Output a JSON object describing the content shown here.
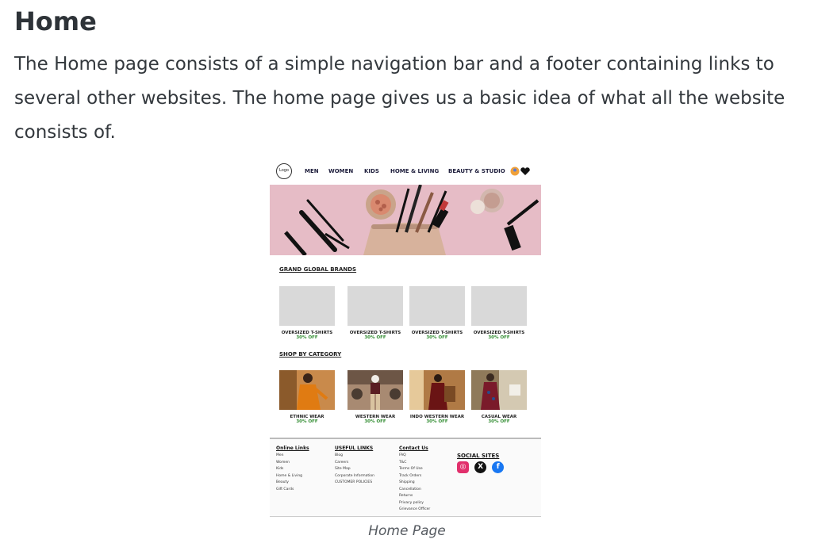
{
  "document": {
    "title": "Home",
    "paragraph": "The Home page consists of a simple navigation bar and a footer containing links to several other websites. The home page gives us a basic idea of what all the website consists of.",
    "caption": "Home Page"
  },
  "mockup": {
    "logo_text": "Logo",
    "nav_items": [
      "MEN",
      "WOMEN",
      "KIDS",
      "HOME & LIVING",
      "BEAUTY & STUDIO"
    ],
    "brands_heading": "GRAND GLOBAL BRANDS",
    "brand_cards": [
      {
        "name": "OVERSIZED T-SHIRTS",
        "offer": "30% OFF"
      },
      {
        "name": "OVERSIZED T-SHIRTS",
        "offer": "30% OFF"
      },
      {
        "name": "OVERSIZED T-SHIRTS",
        "offer": "30% OFF"
      },
      {
        "name": "OVERSIZED T-SHIRTS",
        "offer": "30% OFF"
      }
    ],
    "category_heading": "SHOP BY CATEGORY",
    "category_cards": [
      {
        "name": "ETHNIC WEAR",
        "offer": "30% OFF"
      },
      {
        "name": "WESTERN WEAR",
        "offer": "30% OFF"
      },
      {
        "name": "INDO WESTERN WEAR",
        "offer": "30% OFF"
      },
      {
        "name": "CASUAL WEAR",
        "offer": "30% OFF"
      }
    ],
    "footer": {
      "online_links": {
        "heading": "Online Links",
        "items": [
          "Men",
          "Women",
          "Kids",
          "Home & Living",
          "Beauty",
          "Gift Cards"
        ]
      },
      "useful_links": {
        "heading": "USEFUL LINKS",
        "items": [
          "Blog",
          "Careers",
          "Site Map",
          "Corporate Information",
          "CUSTOMER POLICIES"
        ]
      },
      "contact_us": {
        "heading": "Contact Us",
        "items": [
          "FAQ",
          "T&C",
          "Terms Of Use",
          "Track Orders",
          "Shipping",
          "Cancellation",
          "Returns",
          "Privacy policy",
          "Grievance Officer"
        ]
      },
      "social_heading": "SOCIAL SITES",
      "social_icons": [
        "instagram-icon",
        "x-icon",
        "facebook-icon"
      ],
      "social_glyphs": [
        "◎",
        "X",
        "f"
      ]
    },
    "colors": {
      "offer_green": "#2f8b2f",
      "banner_pink": "#e6bcc6",
      "nav_text": "#1e1e3c"
    }
  }
}
